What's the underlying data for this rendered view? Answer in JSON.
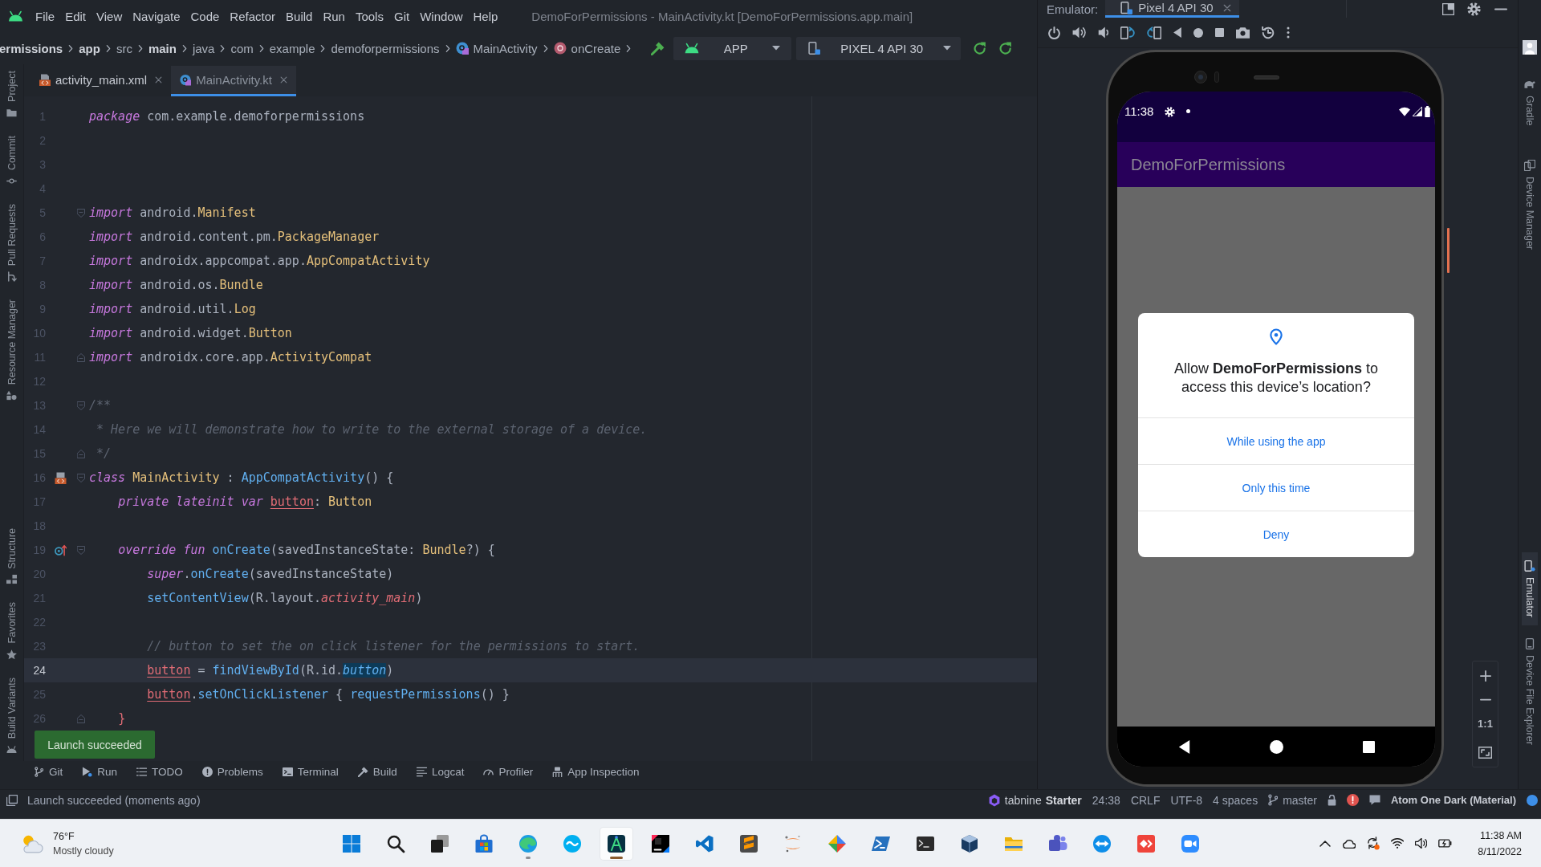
{
  "menu_bar": {
    "items": [
      "File",
      "Edit",
      "View",
      "Navigate",
      "Code",
      "Refactor",
      "Build",
      "Run",
      "Tools",
      "Git",
      "Window",
      "Help"
    ],
    "window_title": "DemoForPermissions - MainActivity.kt [DemoForPermissions.app.main]"
  },
  "breadcrumb": [
    {
      "text": "ermissions",
      "kind": "folder",
      "bold": true
    },
    {
      "text": "app",
      "kind": "folder",
      "bold": true
    },
    {
      "text": "src",
      "kind": "folder",
      "bold": false
    },
    {
      "text": "main",
      "kind": "folder",
      "bold": true
    },
    {
      "text": "java",
      "kind": "folder",
      "bold": false
    },
    {
      "text": "com",
      "kind": "folder",
      "bold": false
    },
    {
      "text": "example",
      "kind": "folder",
      "bold": false
    },
    {
      "text": "demoforpermissions",
      "kind": "folder",
      "bold": false
    },
    {
      "text": "MainActivity",
      "kind": "class",
      "bold": false
    },
    {
      "text": "onCreate",
      "kind": "method",
      "bold": false
    }
  ],
  "run_toolbar": {
    "configuration": "APP",
    "device": "PIXEL 4 API 30"
  },
  "left_tool_strip": {
    "top": [
      {
        "label": "Project",
        "kind": "project",
        "selected": false
      },
      {
        "label": "Commit",
        "kind": "commit",
        "selected": false
      },
      {
        "label": "Pull Requests",
        "kind": "pullrequests",
        "selected": false
      },
      {
        "label": "Resource Manager",
        "kind": "resources",
        "selected": false
      }
    ],
    "bottom": [
      {
        "label": "Structure",
        "kind": "structure",
        "selected": false
      },
      {
        "label": "Favorites",
        "kind": "favorites",
        "selected": false
      },
      {
        "label": "Build Variants",
        "kind": "buildvariants",
        "selected": false
      }
    ]
  },
  "editor_tabs": [
    {
      "label": "activity_main.xml",
      "kind": "xml",
      "selected": false
    },
    {
      "label": "MainActivity.kt",
      "kind": "kotlin",
      "selected": true
    }
  ],
  "editor": {
    "lines": [
      {
        "number": "1",
        "current": false,
        "tokens": [
          {
            "kind": "keyword",
            "text": "package"
          },
          {
            "kind": "plain",
            "text": " com.example.demoforpermissions"
          }
        ]
      },
      {
        "number": "2",
        "current": false
      },
      {
        "number": "3",
        "current": false
      },
      {
        "number": "4",
        "current": false
      },
      {
        "number": "5",
        "current": false,
        "fold": {
          "kind": "open"
        },
        "tokens": [
          {
            "kind": "keyword",
            "text": "import"
          },
          {
            "kind": "plain",
            "text": " android."
          },
          {
            "kind": "type",
            "text": "Manifest"
          }
        ]
      },
      {
        "number": "6",
        "current": false,
        "tokens": [
          {
            "kind": "keyword",
            "text": "import"
          },
          {
            "kind": "plain",
            "text": " android.content.pm."
          },
          {
            "kind": "type",
            "text": "PackageManager"
          }
        ]
      },
      {
        "number": "7",
        "current": false,
        "tokens": [
          {
            "kind": "keyword",
            "text": "import"
          },
          {
            "kind": "plain",
            "text": " androidx.appcompat.app."
          },
          {
            "kind": "type",
            "text": "AppCompatActivity"
          }
        ]
      },
      {
        "number": "8",
        "current": false,
        "tokens": [
          {
            "kind": "keyword",
            "text": "import"
          },
          {
            "kind": "plain",
            "text": " android.os."
          },
          {
            "kind": "type",
            "text": "Bundle"
          }
        ]
      },
      {
        "number": "9",
        "current": false,
        "tokens": [
          {
            "kind": "keyword",
            "text": "import"
          },
          {
            "kind": "plain",
            "text": " android.util."
          },
          {
            "kind": "type",
            "text": "Log"
          }
        ]
      },
      {
        "number": "10",
        "current": false,
        "tokens": [
          {
            "kind": "keyword",
            "text": "import"
          },
          {
            "kind": "plain",
            "text": " android.widget."
          },
          {
            "kind": "type",
            "text": "Button"
          }
        ]
      },
      {
        "number": "11",
        "current": false,
        "fold": {
          "kind": "close"
        },
        "tokens": [
          {
            "kind": "keyword",
            "text": "import"
          },
          {
            "kind": "plain",
            "text": " androidx.core.app."
          },
          {
            "kind": "type",
            "text": "ActivityCompat"
          }
        ]
      },
      {
        "number": "12",
        "current": false
      },
      {
        "number": "13",
        "current": false,
        "fold": {
          "kind": "open"
        },
        "tokens": [
          {
            "kind": "comment",
            "text": "/**"
          }
        ]
      },
      {
        "number": "14",
        "current": false,
        "tokens": [
          {
            "kind": "comment",
            "text": " * Here we will demonstrate how to write to the external storage of a device."
          }
        ]
      },
      {
        "number": "15",
        "current": false,
        "fold": {
          "kind": "close"
        },
        "tokens": [
          {
            "kind": "comment",
            "text": " */"
          }
        ]
      },
      {
        "number": "16",
        "current": false,
        "fold": {
          "kind": "open"
        },
        "gutter_icon": {
          "kind": "layout"
        },
        "tokens": [
          {
            "kind": "keyword",
            "text": "class "
          },
          {
            "kind": "type",
            "text": "MainActivity"
          },
          {
            "kind": "plain",
            "text": " : "
          },
          {
            "kind": "function",
            "text": "AppCompatActivity"
          },
          {
            "kind": "plain",
            "text": "() {"
          }
        ]
      },
      {
        "number": "17",
        "current": false,
        "tokens": [
          {
            "kind": "keyword",
            "text": "    private lateinit var "
          },
          {
            "kind": "field",
            "text": "button"
          },
          {
            "kind": "plain",
            "text": ": "
          },
          {
            "kind": "type",
            "text": "Button"
          }
        ]
      },
      {
        "number": "18",
        "current": false
      },
      {
        "number": "19",
        "current": false,
        "fold": {
          "kind": "open"
        },
        "gutter_icon": {
          "kind": "overrides"
        },
        "tokens": [
          {
            "kind": "keyword",
            "text": "    override fun "
          },
          {
            "kind": "function",
            "text": "onCreate"
          },
          {
            "kind": "plain",
            "text": "(savedInstanceState: "
          },
          {
            "kind": "type",
            "text": "Bundle"
          },
          {
            "kind": "plain",
            "text": "?) {"
          }
        ]
      },
      {
        "number": "20",
        "current": false,
        "tokens": [
          {
            "kind": "keyword",
            "text": "        super"
          },
          {
            "kind": "plain",
            "text": "."
          },
          {
            "kind": "function",
            "text": "onCreate"
          },
          {
            "kind": "plain",
            "text": "(savedInstanceState)"
          }
        ]
      },
      {
        "number": "21",
        "current": false,
        "tokens": [
          {
            "kind": "function",
            "text": "        setContentView"
          },
          {
            "kind": "plain",
            "text": "(R.layout."
          },
          {
            "kind": "reference",
            "text": "activity_main"
          },
          {
            "kind": "plain",
            "text": ")"
          }
        ]
      },
      {
        "number": "22",
        "current": false
      },
      {
        "number": "23",
        "current": false,
        "tokens": [
          {
            "kind": "comment",
            "text": "        // button to set the on click listener for the permissions to start."
          }
        ]
      },
      {
        "number": "24",
        "current": true,
        "tokens": [
          {
            "kind": "field",
            "text": "        button"
          },
          {
            "kind": "plain",
            "text": " = "
          },
          {
            "kind": "function",
            "text": "findViewById"
          },
          {
            "kind": "plain",
            "text": "(R.id."
          },
          {
            "kind": "usage",
            "text": "button"
          },
          {
            "kind": "plain",
            "text": ")"
          }
        ]
      },
      {
        "number": "25",
        "current": false,
        "tokens": [
          {
            "kind": "field",
            "text": "        button"
          },
          {
            "kind": "plain",
            "text": "."
          },
          {
            "kind": "function",
            "text": "setOnClickListener"
          },
          {
            "kind": "plain",
            "text": " { "
          },
          {
            "kind": "function",
            "text": "requestPermissions"
          },
          {
            "kind": "plain",
            "text": "() }"
          }
        ]
      },
      {
        "number": "26",
        "current": false,
        "fold": {
          "kind": "close"
        },
        "tokens": [
          {
            "kind": "bracket",
            "text": "    }"
          }
        ]
      }
    ]
  },
  "notification": {
    "text": "Launch succeeded"
  },
  "tool_window_bar": [
    {
      "label": "Git",
      "kind": "git",
      "selected": false
    },
    {
      "label": "Run",
      "kind": "run",
      "selected": false
    },
    {
      "label": "TODO",
      "kind": "todo",
      "selected": false
    },
    {
      "label": "Problems",
      "kind": "problems",
      "selected": false
    },
    {
      "label": "Terminal",
      "kind": "terminal",
      "selected": false
    },
    {
      "label": "Build",
      "kind": "build",
      "selected": false
    },
    {
      "label": "Logcat",
      "kind": "logcat",
      "selected": false
    },
    {
      "label": "Profiler",
      "kind": "profiler",
      "selected": false
    },
    {
      "label": "App Inspection",
      "kind": "inspection",
      "selected": false
    }
  ],
  "emulator": {
    "label": "Emulator:",
    "tabs": [
      {
        "label": "Pixel 4 API 30",
        "selected": true
      }
    ],
    "device_screen": {
      "status_time": "11:38",
      "app_title": "DemoForPermissions",
      "dialog": {
        "message": "Allow **DemoForPermissions** to access this device’s location?",
        "buttons": [
          "While using the app",
          "Only this time",
          "Deny"
        ]
      }
    },
    "zoom_controls": {
      "actual_size": "1:1"
    }
  },
  "right_tool_strip": {
    "top": [
      {
        "label": "Gradle",
        "kind": "gradle",
        "selected": false
      },
      {
        "label": "Device Manager",
        "kind": "devicemanager",
        "selected": false
      }
    ],
    "bottom": [
      {
        "label": "Emulator",
        "kind": "emulator",
        "selected": true
      },
      {
        "label": "Device File Explorer",
        "kind": "fileexplorer",
        "selected": false
      }
    ]
  },
  "status_bar": {
    "message": "Launch succeeded (moments ago)",
    "plugin_name": "tabnine",
    "plugin_plan": "Starter",
    "caret_position": "24:38",
    "line_separator": "CRLF",
    "encoding": "UTF-8",
    "indent": "4 spaces",
    "branch": "master",
    "theme": "Atom One Dark (Material)"
  },
  "taskbar": {
    "weather": {
      "temperature": "76°F",
      "condition": "Mostly cloudy"
    },
    "apps": [
      {
        "kind": "start",
        "running": false,
        "active": false
      },
      {
        "kind": "search",
        "running": false,
        "active": false
      },
      {
        "kind": "taskview",
        "running": false,
        "active": false
      },
      {
        "kind": "store",
        "running": false,
        "active": false
      },
      {
        "kind": "browser",
        "running": true,
        "active": false
      },
      {
        "kind": "messenger",
        "running": false,
        "active": false
      },
      {
        "kind": "androidide",
        "running": true,
        "active": true
      },
      {
        "kind": "javaide",
        "running": false,
        "active": false
      },
      {
        "kind": "codeeditor",
        "running": false,
        "active": false
      },
      {
        "kind": "texteditor",
        "running": false,
        "active": false
      },
      {
        "kind": "notebook",
        "running": false,
        "active": false
      },
      {
        "kind": "gitclient",
        "running": false,
        "active": false
      },
      {
        "kind": "shell",
        "running": false,
        "active": false
      },
      {
        "kind": "terminal",
        "running": false,
        "active": false
      },
      {
        "kind": "virtualmachine",
        "running": false,
        "active": false
      },
      {
        "kind": "files",
        "running": false,
        "active": false
      },
      {
        "kind": "teamchat",
        "running": false,
        "active": false
      },
      {
        "kind": "remotecontrol",
        "running": false,
        "active": false
      },
      {
        "kind": "remotedesktop",
        "running": false,
        "active": false
      },
      {
        "kind": "videocall",
        "running": false,
        "active": false
      }
    ],
    "clock": {
      "time": "11:38 AM",
      "date": "8/11/2022"
    }
  }
}
